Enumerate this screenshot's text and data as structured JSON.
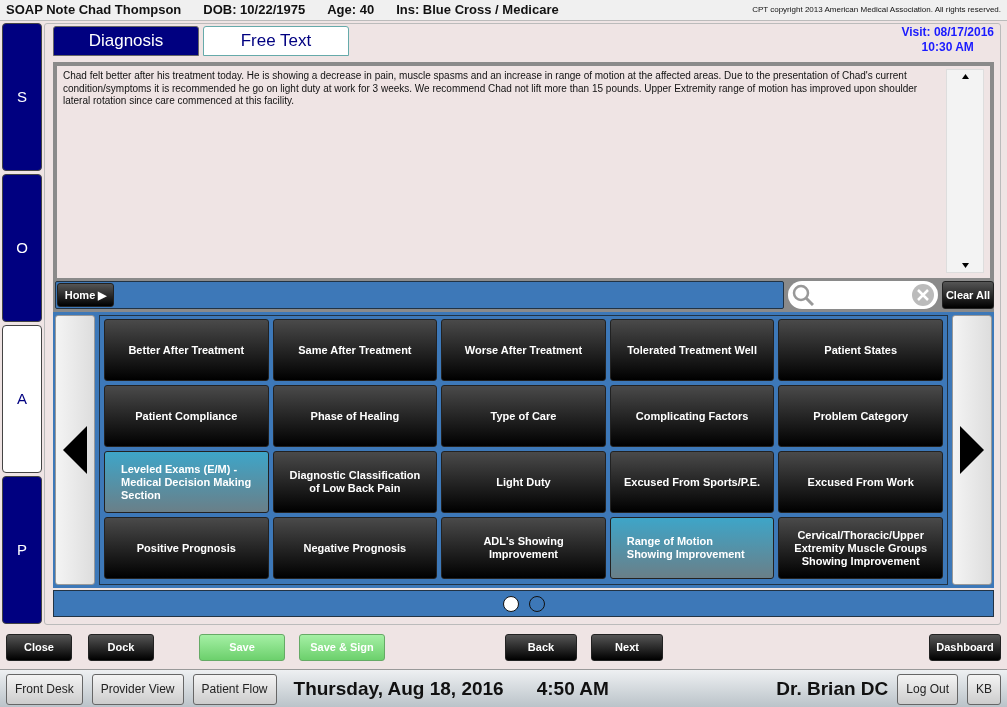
{
  "header": {
    "patient": "SOAP Note Chad Thompson",
    "dob": "DOB: 10/22/1975",
    "age": "Age: 40",
    "insurance": "Ins: Blue Cross / Medicare",
    "copyright": "CPT copyright 2013 American Medical Association. All rights reserved."
  },
  "soap_tabs": [
    {
      "label": "S",
      "selected": false
    },
    {
      "label": "O",
      "selected": false
    },
    {
      "label": "A",
      "selected": true
    },
    {
      "label": "P",
      "selected": false
    }
  ],
  "tabs": [
    {
      "label": "Diagnosis",
      "selected": false
    },
    {
      "label": "Free Text",
      "selected": true
    }
  ],
  "visit": {
    "date": "Visit: 08/17/2016",
    "time": "10:30 AM"
  },
  "note_text": "Chad felt better after his treatment today.  He is showing a decrease in pain, muscle spasms and an increase in range of motion at the affected areas.  Due to the presentation of Chad's current condition/symptoms it is recommended he go on light duty at work for 3 weeks.  We recommend Chad not lift more than 15 pounds.  Upper Extremity range of motion has improved upon shoulder lateral rotation since care commenced at this facility.",
  "toolbar": {
    "home": "Home ▶",
    "clear_all": "Clear All"
  },
  "phrases": [
    {
      "label": "Better After Treatment",
      "selected": false
    },
    {
      "label": "Same After Treatment",
      "selected": false
    },
    {
      "label": "Worse After Treatment",
      "selected": false
    },
    {
      "label": "Tolerated Treatment Well",
      "selected": false
    },
    {
      "label": "Patient States",
      "selected": false
    },
    {
      "label": "Patient Compliance",
      "selected": false
    },
    {
      "label": "Phase of Healing",
      "selected": false
    },
    {
      "label": "Type of Care",
      "selected": false
    },
    {
      "label": "Complicating Factors",
      "selected": false
    },
    {
      "label": "Problem Category",
      "selected": false
    },
    {
      "label": "Leveled Exams (E/M) - Medical Decision Making Section",
      "selected": true
    },
    {
      "label": "Diagnostic Classification of Low Back Pain",
      "selected": false
    },
    {
      "label": "Light Duty",
      "selected": false
    },
    {
      "label": "Excused From Sports/P.E.",
      "selected": false
    },
    {
      "label": "Excused From Work",
      "selected": false
    },
    {
      "label": "Positive Prognosis",
      "selected": false
    },
    {
      "label": "Negative Prognosis",
      "selected": false
    },
    {
      "label": "ADL's Showing Improvement",
      "selected": false
    },
    {
      "label": "Range of Motion Showing Improvement",
      "selected": true
    },
    {
      "label": "Cervical/Thoracic/Upper Extremity Muscle Groups Showing Improvement",
      "selected": false
    }
  ],
  "pages": [
    {
      "selected": true
    },
    {
      "selected": false
    }
  ],
  "actions": [
    {
      "label": "Close",
      "kind": "dark"
    },
    {
      "label": "Dock",
      "kind": "dark"
    },
    {
      "label": "Save",
      "kind": "green"
    },
    {
      "label": "Save & Sign",
      "kind": "green"
    },
    {
      "label": "Back",
      "kind": "dark"
    },
    {
      "label": "Next",
      "kind": "dark"
    },
    {
      "label": "Dashboard",
      "kind": "dark"
    }
  ],
  "status_bar": {
    "buttons_left": [
      "Front Desk",
      "Provider View",
      "Patient Flow"
    ],
    "date": "Thursday, Aug 18, 2016",
    "time": "4:50 AM",
    "user": "Dr. Brian DC",
    "buttons_right": [
      "Log Out",
      "KB"
    ]
  }
}
